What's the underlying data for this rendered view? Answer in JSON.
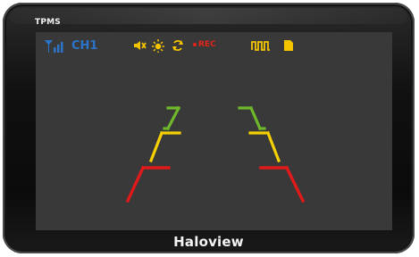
{
  "device": {
    "top_label": "TPMS",
    "brand": "Haloview"
  },
  "status_bar": {
    "signal_icon": "signal-bars-icon",
    "channel_label": "CH1",
    "icons": [
      "speaker-mute-icon",
      "brightness-icon",
      "rotate-icon",
      "pulse-wave-icon",
      "sd-card-icon"
    ],
    "rec_label": "REC",
    "colors": {
      "channel": "#2c74c9",
      "status_icons": "#f4c400",
      "rec": "#e1251b"
    }
  },
  "guides": {
    "colors": {
      "near": "#e01a1a",
      "mid": "#f4d000",
      "far": "#6fb82b"
    }
  }
}
